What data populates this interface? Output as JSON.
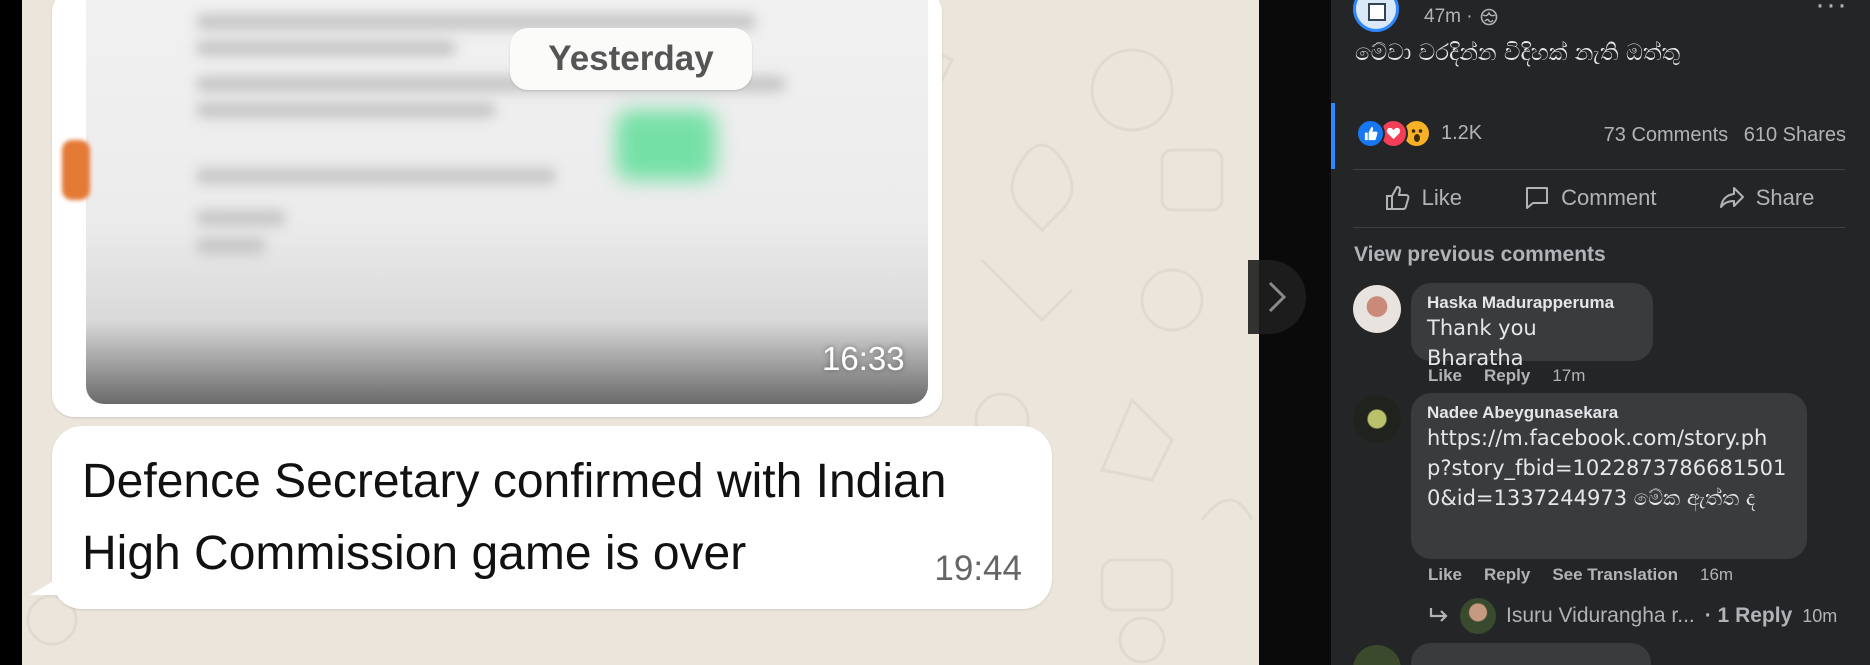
{
  "chat": {
    "date_divider": "Yesterday",
    "image_message": {
      "time": "16:33"
    },
    "text_message": {
      "text": "Defence Secretary confirmed with Indian High Commission game is over",
      "time": "19:44"
    }
  },
  "viewer": {
    "next_icon": "chevron-right-icon"
  },
  "post": {
    "time": "47m",
    "separator": "·",
    "text": "මේවා වරදින්න විදිහක් නැති ඔත්තු",
    "reactions": {
      "icons": [
        "like",
        "love",
        "wow"
      ],
      "count": "1.2K"
    },
    "comments_count": "73 Comments",
    "shares_count": "610 Shares",
    "actions": {
      "like": "Like",
      "comment": "Comment",
      "share": "Share"
    }
  },
  "comments": {
    "view_previous": "View previous comments",
    "items": [
      {
        "name": "Haska Madurapperuma",
        "text": "Thank you Bharatha",
        "like": "Like",
        "reply": "Reply",
        "time": "17m"
      },
      {
        "name": "Nadee Abeygunasekara",
        "text": "https://m.facebook.com/story.php?story_fbid=10228737866815010&id=1337244973 මේක ඇත්ත ද",
        "like": "Like",
        "reply": "Reply",
        "see_translation": "See Translation",
        "time": "16m",
        "reply_preview": {
          "name": "Isuru Vidurangha r...",
          "count": "· 1 Reply",
          "time": "10m"
        }
      }
    ]
  },
  "colors": {
    "fb_background": "#242526",
    "fb_accent": "#2d88ff",
    "chat_wallpaper": "#ebe5dc",
    "bubble": "#ffffff"
  }
}
